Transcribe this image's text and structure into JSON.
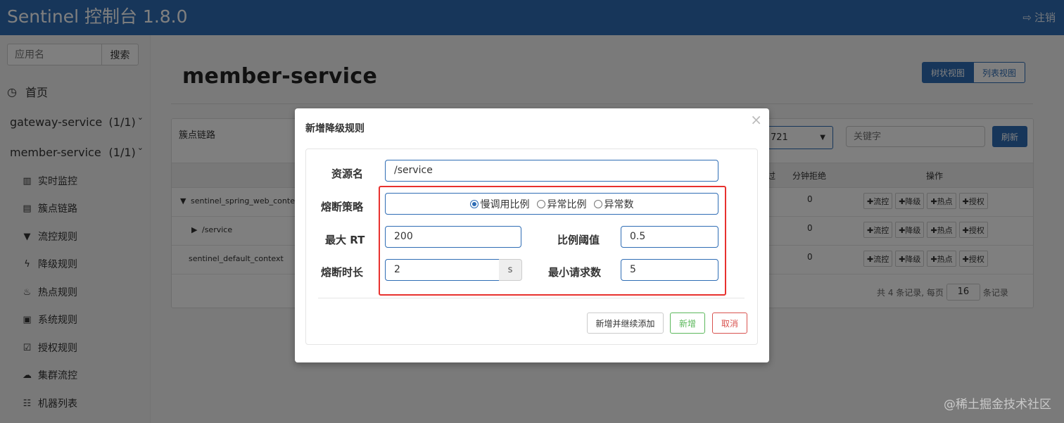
{
  "header": {
    "title": "Sentinel 控制台 1.8.0",
    "logout_label": "注销",
    "logout_icon": "sign-out-icon"
  },
  "sidebar": {
    "search_placeholder": "应用名",
    "search_button": "搜索",
    "home_label": "首页",
    "home_icon": "dashboard-icon",
    "apps": [
      {
        "name": "gateway-service",
        "count": "(1/1)"
      },
      {
        "name": "member-service",
        "count": "(1/1)"
      }
    ],
    "menu": [
      {
        "label": "实时监控",
        "icon": "bar-chart-icon"
      },
      {
        "label": "簇点链路",
        "icon": "list-icon"
      },
      {
        "label": "流控规则",
        "icon": "filter-icon"
      },
      {
        "label": "降级规则",
        "icon": "flash-icon"
      },
      {
        "label": "热点规则",
        "icon": "fire-icon"
      },
      {
        "label": "系统规则",
        "icon": "lock-icon"
      },
      {
        "label": "授权规则",
        "icon": "check-icon"
      },
      {
        "label": "集群流控",
        "icon": "cloud-icon"
      },
      {
        "label": "机器列表",
        "icon": "grid-list-icon"
      }
    ]
  },
  "main": {
    "title": "member-service",
    "views": {
      "tree": "树状视图",
      "list": "列表视图"
    },
    "panel": {
      "title": "簇点链路",
      "machine": "721",
      "keyword_placeholder": "关键字",
      "refresh": "刷新",
      "columns": {
        "pass": "过",
        "reject": "分钟拒绝",
        "ops": "操作"
      },
      "rows": [
        {
          "name": "sentinel_spring_web_contex",
          "toggle": "▼",
          "value": "0"
        },
        {
          "name": "/service",
          "toggle": "▶",
          "value": "0"
        },
        {
          "name": "sentinel_default_context",
          "toggle": "",
          "value": "0"
        }
      ],
      "ops": [
        "✚流控",
        "✚降级",
        "✚热点",
        "✚授权"
      ],
      "pager": {
        "prefix": "共 4 条记录, 每页",
        "size": "16",
        "suffix": "条记录"
      }
    }
  },
  "modal": {
    "title": "新增降级规则",
    "close": "×",
    "resource_label": "资源名",
    "resource_value": "/service",
    "strategy_label": "熔断策略",
    "strategies": [
      "慢调用比例",
      "异常比例",
      "异常数"
    ],
    "selected_strategy": "慢调用比例",
    "max_rt_label": "最大 RT",
    "max_rt_value": "200",
    "ratio_label": "比例阈值",
    "ratio_value": "0.5",
    "duration_label": "熔断时长",
    "duration_value": "2",
    "duration_unit": "s",
    "min_req_label": "最小请求数",
    "min_req_value": "5",
    "buttons": {
      "continue": "新增并继续添加",
      "add": "新增",
      "cancel": "取消"
    },
    "highlight_color": "#e8312e"
  },
  "watermark": "@稀土掘金技术社区"
}
